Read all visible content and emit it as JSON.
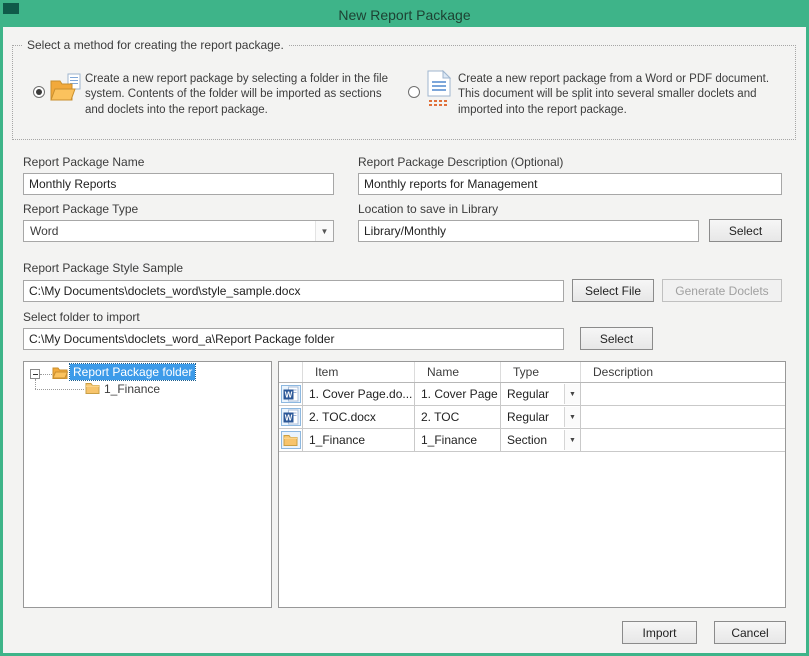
{
  "window": {
    "title": "New Report Package"
  },
  "colors": {
    "accent_green": "#3eb489",
    "selection_blue": "#3d9be9",
    "word_blue": "#2b5797",
    "folder_amber": "#f7c46c"
  },
  "method_group": {
    "legend": "Select a method for creating the report package.",
    "options": [
      {
        "icon": "folder-import-icon",
        "selected": true,
        "text": "Create a new report package by selecting a folder in the file system. Contents of the folder will be imported as sections and doclets into the report package."
      },
      {
        "icon": "document-split-icon",
        "selected": false,
        "text": "Create a new report package from a Word or PDF document. This document will be split into several smaller doclets and imported into the report package."
      }
    ]
  },
  "fields": {
    "name": {
      "label": "Report Package Name",
      "value": "Monthly Reports"
    },
    "description": {
      "label": "Report Package Description (Optional)",
      "value": "Monthly reports for Management"
    },
    "type": {
      "label": "Report Package Type",
      "value": "Word"
    },
    "location": {
      "label": "Location to save in Library",
      "value": "Library/Monthly",
      "button_label": "Select"
    },
    "style_sample": {
      "label": "Report Package Style Sample",
      "value": "C:\\My Documents\\doclets_word\\style_sample.docx",
      "select_file_label": "Select File",
      "generate_doclets_label": "Generate Doclets"
    },
    "import_folder": {
      "label": "Select folder to import",
      "value": "C:\\My Documents\\doclets_word_a\\Report Package folder",
      "button_label": "Select"
    }
  },
  "tree": {
    "root_label": "Report Package folder",
    "child_label": "1_Finance"
  },
  "table": {
    "columns": [
      "Item",
      "Name",
      "Type",
      "Description"
    ],
    "rows": [
      {
        "icon": "word-doc-icon",
        "item": "1. Cover Page.do...",
        "name": "1. Cover Page",
        "type": "Regular",
        "description": ""
      },
      {
        "icon": "word-doc-icon",
        "item": "2. TOC.docx",
        "name": "2. TOC",
        "type": "Regular",
        "description": ""
      },
      {
        "icon": "folder-icon",
        "item": "1_Finance",
        "name": "1_Finance",
        "type": "Section",
        "description": ""
      }
    ]
  },
  "footer": {
    "import_label": "Import",
    "cancel_label": "Cancel"
  }
}
